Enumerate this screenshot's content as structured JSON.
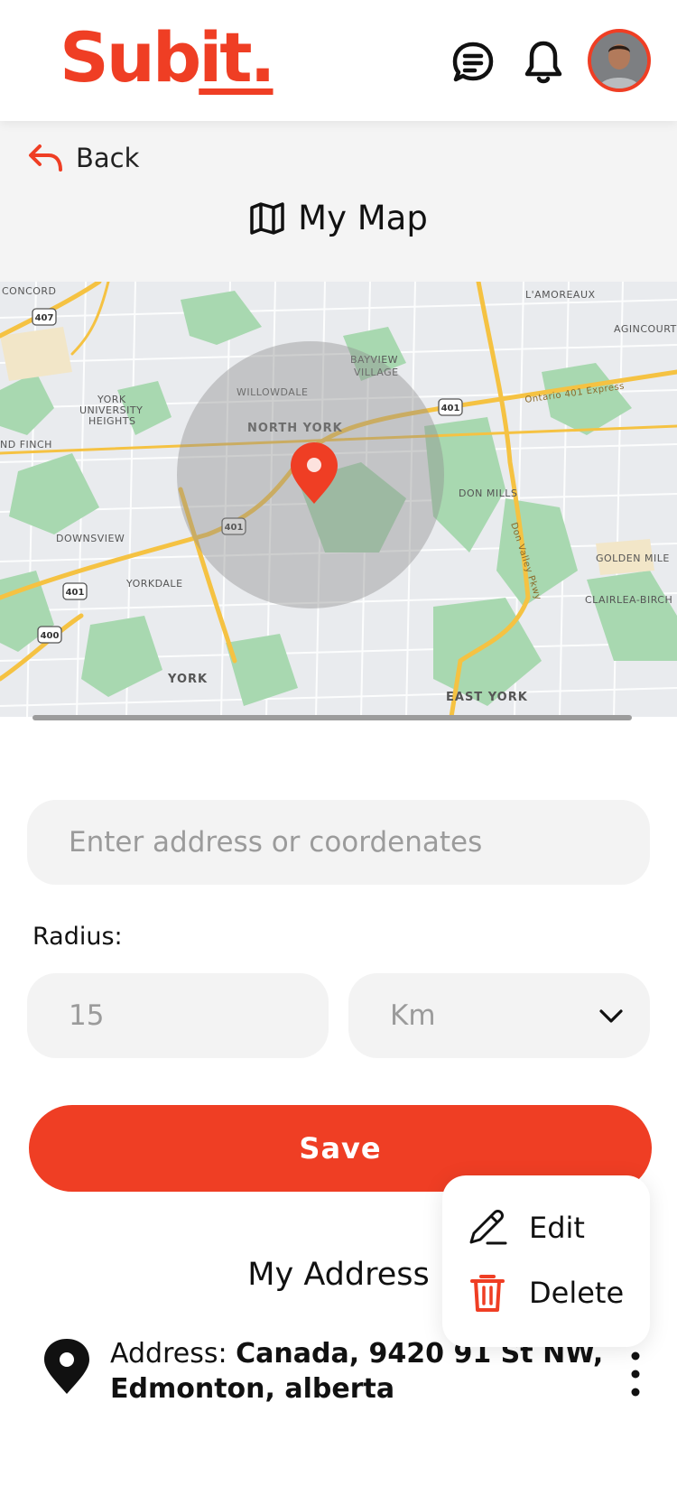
{
  "app": {
    "logo_main": "Sub",
    "logo_accent": "it."
  },
  "header": {
    "chat_icon": "chat-bubble-icon",
    "bell_icon": "bell-icon",
    "avatar": "user-avatar"
  },
  "nav": {
    "back_label": "Back",
    "page_title": "My Map",
    "page_icon": "map-icon"
  },
  "map": {
    "labels": {
      "concord": "CONCORD",
      "lamoreaux": "L'AMOREAUX",
      "agincourt": "AGINCOURT",
      "bayview": "BAYVIEW",
      "village": "VILLAGE",
      "willowdale": "WILLOWDALE",
      "york": "YORK",
      "university": "UNIVERSITY",
      "heights": "HEIGHTS",
      "finch": "ND FINCH",
      "north_york": "NORTH YORK",
      "don_mills": "DON MILLS",
      "downsview": "DOWNSVIEW",
      "yorkdale": "YORKDALE",
      "york_south": "YORK",
      "east_york": "EAST YORK",
      "golden_mile": "GOLDEN MILE",
      "clairlea": "CLAIRLEA-BIRCH",
      "ontario401": "Ontario 401 Express",
      "don_valley": "Don Valley Pkwy",
      "hw407": "407",
      "hw401a": "401",
      "hw401b": "401",
      "hw401c": "401",
      "hw400": "400"
    }
  },
  "form": {
    "address_placeholder": "Enter address or coordenates",
    "radius_label": "Radius:",
    "radius_value": "15",
    "unit_value": "Km",
    "save_label": "Save"
  },
  "addresses": {
    "section_title": "My Address",
    "items": [
      {
        "prefix": "Address: ",
        "value": "Canada, 9420 91 St NW, Edmonton, alberta"
      }
    ]
  },
  "menu": {
    "edit_label": "Edit",
    "delete_label": "Delete"
  },
  "colors": {
    "brand": "#ef3e24",
    "field_bg": "#f3f3f3",
    "map_bg": "#e9ebee",
    "park": "#a8d8b0",
    "road": "#f5c242"
  }
}
